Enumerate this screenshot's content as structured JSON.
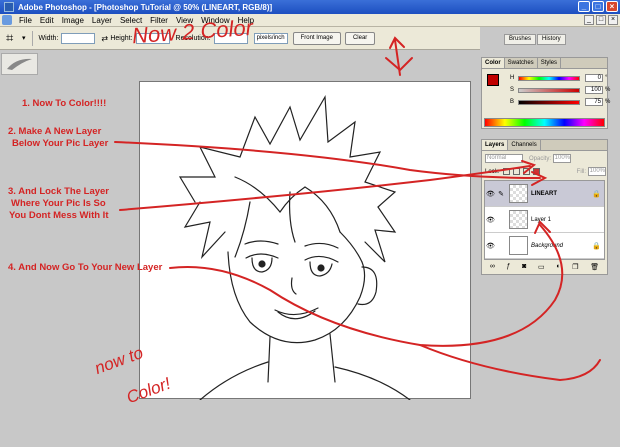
{
  "window": {
    "title": "Adobe Photoshop - [Photoshop TuTorial @ 50% (LINEART, RGB/8)]",
    "buttons": [
      "_",
      "□",
      "×"
    ]
  },
  "menu": [
    "File",
    "Edit",
    "Image",
    "Layer",
    "Select",
    "Filter",
    "View",
    "Window",
    "Help"
  ],
  "options": {
    "width_label": "Width:",
    "height_label": "Height:",
    "resolution_label": "Resolution:",
    "units": "pixels/inch",
    "front_image": "Front Image",
    "clear": "Clear"
  },
  "palette_well": [
    "Brushes",
    "History"
  ],
  "color_panel": {
    "tabs": [
      "Color",
      "Swatches",
      "Styles"
    ],
    "fg": "#c00000",
    "bg": "#f2e3c8",
    "channels": [
      {
        "label": "H",
        "value": "0",
        "unit": "°"
      },
      {
        "label": "S",
        "value": "100",
        "unit": "%"
      },
      {
        "label": "B",
        "value": "75",
        "unit": "%"
      }
    ]
  },
  "layers_panel": {
    "tabs": [
      "Layers",
      "Channels"
    ],
    "blend_mode": "Normal",
    "opacity_label": "Opacity:",
    "opacity": "100%",
    "lock_label": "Lock:",
    "fill_label": "Fill:",
    "fill": "100%",
    "layers": [
      {
        "name": "LINEART",
        "active": true,
        "locked": true
      },
      {
        "name": "Layer 1",
        "active": false,
        "locked": false
      },
      {
        "name": "Background",
        "active": false,
        "locked": true
      }
    ],
    "footer_icons": [
      "link-icon",
      "style-icon",
      "mask-icon",
      "set-icon",
      "adjust-icon",
      "new-layer-icon",
      "trash-icon"
    ]
  },
  "annotations": {
    "header": "Now 2 Color",
    "steps": [
      "1. Now To Color!!!!",
      "2. Make A New Layer",
      "Below Your Pic Layer",
      "3. And Lock The Layer",
      "Where Your Pic Is So",
      "You Dont Mess With It",
      "4. And Now Go To Your New Layer"
    ],
    "side_note": [
      "now to",
      "Color!"
    ],
    "ink_color": "#d42424"
  }
}
